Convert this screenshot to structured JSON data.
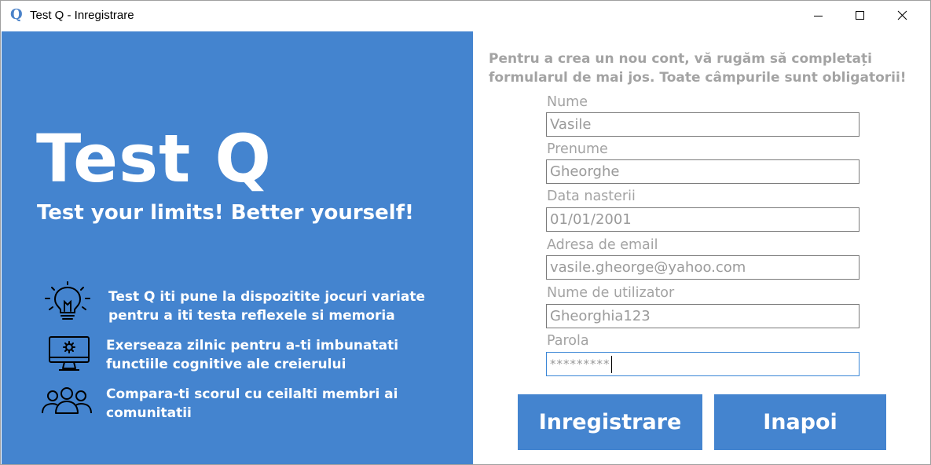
{
  "window": {
    "icon_letter": "Q",
    "title": "Test Q - Inregistrare",
    "controls": [
      "minimize",
      "maximize",
      "close"
    ]
  },
  "left": {
    "brand": "Test Q",
    "tagline": "Test your limits! Better yourself!",
    "features": [
      {
        "icon": "lightbulb-icon",
        "text": "Test Q iti pune la dispozitite jocuri variate pentru a iti testa reflexele si memoria"
      },
      {
        "icon": "monitor-gear-icon",
        "text": "Exerseaza zilnic pentru a-ti imbunatati functiile cognitive ale creierului"
      },
      {
        "icon": "users-group-icon",
        "text": "Compara-ti scorul cu ceilalti membri ai comunitatii"
      }
    ],
    "colors": {
      "panel_bg": "#4484cf",
      "text": "#ffffff"
    }
  },
  "form": {
    "intro": "Pentru a crea un nou cont, vă rugăm să completați formularul de mai jos. Toate câmpurile sunt obligatorii!",
    "fields": [
      {
        "label": "Nume",
        "value": "Vasile"
      },
      {
        "label": "Prenume",
        "value": "Gheorghe"
      },
      {
        "label": "Data nasterii",
        "value": "01/01/2001"
      },
      {
        "label": "Adresa de email",
        "value": "vasile.gheorge@yahoo.com"
      },
      {
        "label": "Nume de utilizator",
        "value": "Gheorghia123"
      },
      {
        "label": "Parola",
        "value": "*********"
      }
    ],
    "buttons": {
      "register": "Inregistrare",
      "back": "Inapoi"
    },
    "colors": {
      "label": "#a3a3a3",
      "button_bg": "#4484cf",
      "focus_border": "#3a86d6"
    }
  }
}
